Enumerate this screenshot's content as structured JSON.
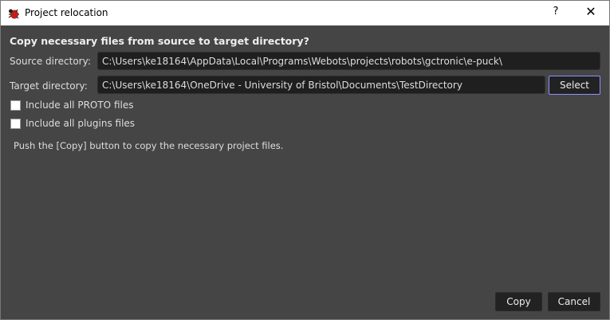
{
  "window": {
    "title": "Project relocation",
    "help": "?",
    "close": "✕"
  },
  "heading": "Copy necessary files from source to target directory?",
  "source": {
    "label": "Source directory:",
    "value": "C:\\Users\\ke18164\\AppData\\Local\\Programs\\Webots\\projects\\robots\\gctronic\\e-puck\\"
  },
  "target": {
    "label": "Target directory:",
    "value": "C:\\Users\\ke18164\\OneDrive - University of Bristol\\Documents\\TestDirectory",
    "select": "Select"
  },
  "options": [
    {
      "label": "Include all PROTO files",
      "checked": false
    },
    {
      "label": "Include all plugins files",
      "checked": false
    }
  ],
  "message": "Push the [Copy] button to copy the necessary project files.",
  "buttons": {
    "copy": "Copy",
    "cancel": "Cancel"
  },
  "colors": {
    "accent": "#8f8fff",
    "background": "#454545"
  }
}
